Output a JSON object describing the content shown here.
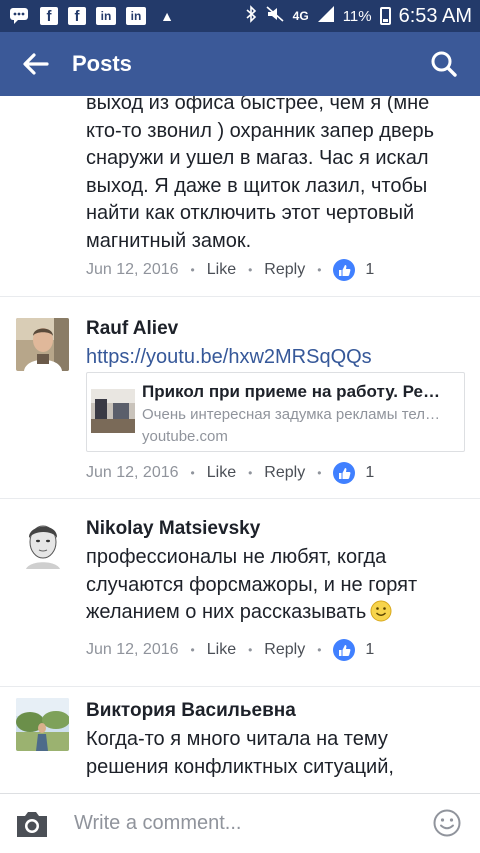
{
  "status_bar": {
    "icons_left": [
      "messages-icon",
      "facebook-icon",
      "facebook-icon",
      "linkedin-icon",
      "linkedin-icon",
      "warning-icon"
    ],
    "network": "4G",
    "battery": "11%",
    "time": "6:53 AM",
    "fb_glyph": "f",
    "in_glyph": "in",
    "warn_glyph": "▲"
  },
  "app_bar": {
    "title": "Posts"
  },
  "comments": [
    {
      "id": "partial",
      "text": "выход из офиса  быстрее, чем я (мне кто-то звонил ) охранник запер дверь снаружи и ушел в магаз. Час я искал выход. Я даже в щиток лазил, чтобы найти как отключить этот чертовый магнитный замок.",
      "date": "Jun 12, 2016",
      "like_label": "Like",
      "reply_label": "Reply",
      "like_count": "1"
    },
    {
      "id": "rauf",
      "author": "Rauf Aliev",
      "link": "https://youtu.be/hxw2MRSqQQs",
      "card": {
        "title": "Прикол при приеме на работу. Ре…",
        "description": "Очень интересная задумка рекламы тел…",
        "domain": "youtube.com"
      },
      "date": "Jun 12, 2016",
      "like_label": "Like",
      "reply_label": "Reply",
      "like_count": "1"
    },
    {
      "id": "nikolay",
      "author": "Nikolay Matsievsky",
      "text": "профессионалы не любят, когда случаются форсмажоры, и не горят желанием о них рассказывать",
      "date": "Jun 12, 2016",
      "like_label": "Like",
      "reply_label": "Reply",
      "like_count": "1"
    },
    {
      "id": "viktoria",
      "author": "Виктория Васильевна",
      "text": "Когда-то я много читала на тему решения конфликтных ситуаций,"
    }
  ],
  "composer": {
    "placeholder": "Write a comment..."
  },
  "separator": "•",
  "colors": {
    "status_bar": "#233a6a",
    "app_bar": "#3b5998",
    "like_badge": "#4080ff",
    "link": "#365899",
    "meta": "#90949c"
  }
}
